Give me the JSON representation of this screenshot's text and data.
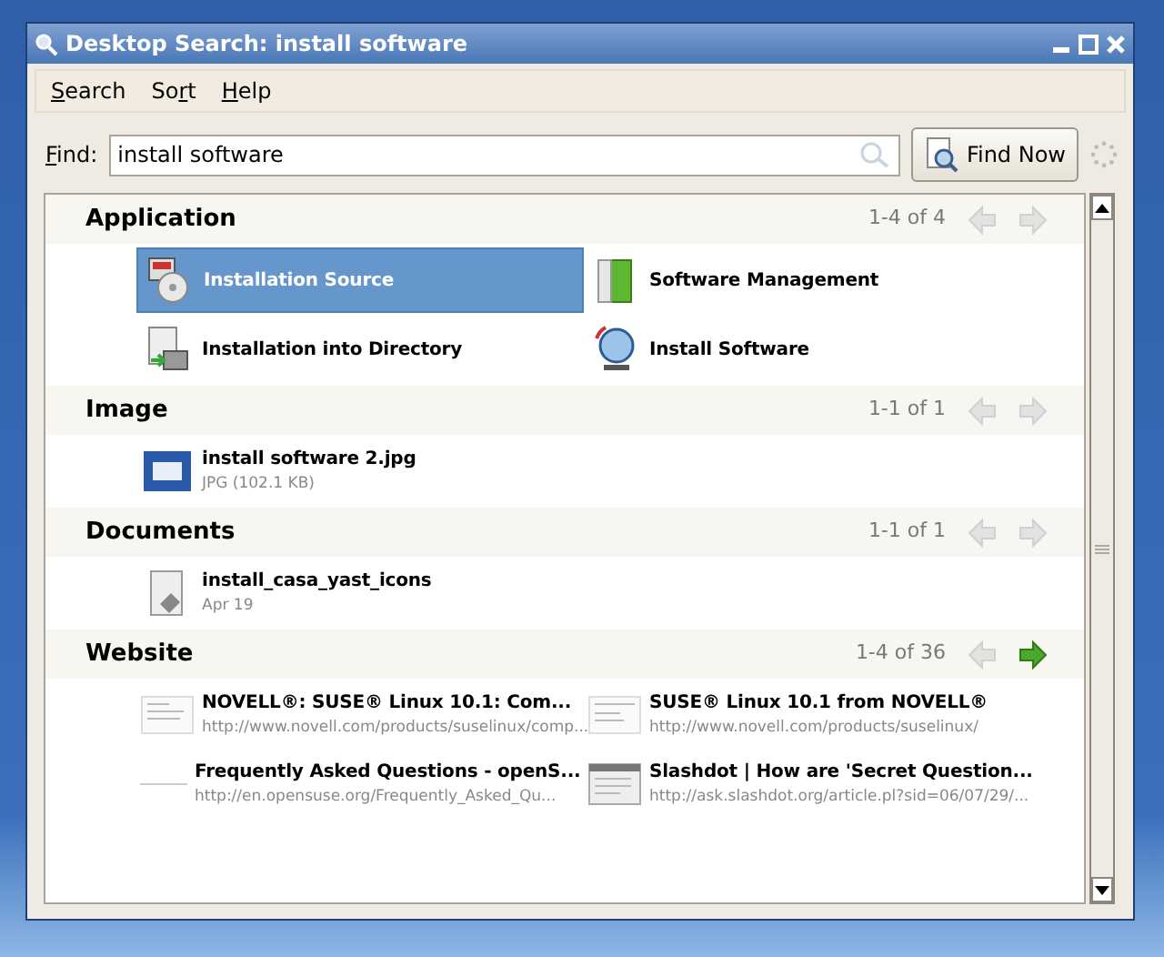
{
  "window": {
    "title": "Desktop Search: install software"
  },
  "menu": [
    {
      "parts": [
        {
          "text": "S",
          "underline": true
        },
        {
          "text": "earch",
          "underline": false
        }
      ]
    },
    {
      "parts": [
        {
          "text": "So",
          "underline": false
        },
        {
          "text": "r",
          "underline": true
        },
        {
          "text": "t",
          "underline": false
        }
      ]
    },
    {
      "parts": [
        {
          "text": "H",
          "underline": true
        },
        {
          "text": "elp",
          "underline": false
        }
      ]
    }
  ],
  "find": {
    "label_parts": [
      {
        "text": "F",
        "underline": true
      },
      {
        "text": "ind:",
        "underline": false
      }
    ],
    "value": "install software",
    "button": "Find Now"
  },
  "sections": [
    {
      "kind": "application",
      "title": "Application",
      "range": "1-4 of 4",
      "prev_enabled": false,
      "next_enabled": false,
      "items": [
        {
          "title": "Installation Source",
          "selected": true
        },
        {
          "title": "Software Management",
          "selected": false
        },
        {
          "title": "Installation into Directory",
          "selected": false
        },
        {
          "title": "Install Software",
          "selected": false
        }
      ]
    },
    {
      "kind": "image",
      "title": "Image",
      "range": "1-1 of 1",
      "prev_enabled": false,
      "next_enabled": false,
      "items": [
        {
          "title": "install software 2.jpg",
          "subtitle": "JPG (102.1 KB)",
          "selected": false
        }
      ]
    },
    {
      "kind": "document",
      "title": "Documents",
      "range": "1-1 of 1",
      "prev_enabled": false,
      "next_enabled": false,
      "items": [
        {
          "title": "install_casa_yast_icons",
          "subtitle": "Apr 19",
          "selected": false
        }
      ]
    },
    {
      "kind": "website",
      "title": "Website",
      "range": "1-4 of 36",
      "prev_enabled": false,
      "next_enabled": true,
      "items": [
        {
          "title": "NOVELL®: SUSE® Linux 10.1: Com...",
          "subtitle": "http://www.novell.com/products/suselinux/comp...",
          "selected": false
        },
        {
          "title": "SUSE® Linux 10.1 from NOVELL®",
          "subtitle": "http://www.novell.com/products/suselinux/",
          "selected": false
        },
        {
          "title": "Frequently Asked Questions - openS...",
          "subtitle": "http://en.opensuse.org/Frequently_Asked_Qu...",
          "selected": false
        },
        {
          "title": "Slashdot | How are 'Secret Question...",
          "subtitle": "http://ask.slashdot.org/article.pl?sid=06/07/29/...",
          "selected": false
        }
      ]
    }
  ]
}
